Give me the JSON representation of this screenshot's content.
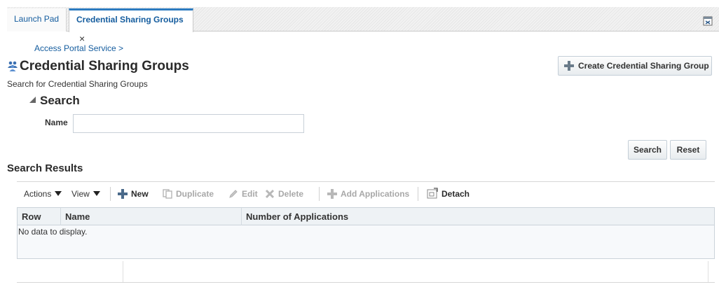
{
  "tabs": [
    {
      "label": "Launch Pad",
      "active": false
    },
    {
      "label": "Credential Sharing Groups",
      "active": true,
      "close": "×"
    }
  ],
  "window": {
    "maximize_icon": "maximize-icon"
  },
  "header": {
    "breadcrumb": "Access Portal Service >",
    "title": "Credential Sharing Groups",
    "title_icon": "people-group-icon",
    "description": "Search for Credential Sharing Groups",
    "create_button": "Create Credential Sharing Group"
  },
  "search": {
    "header": "Search",
    "name_label": "Name",
    "name_value": "",
    "search_button": "Search",
    "reset_button": "Reset"
  },
  "results": {
    "header": "Search Results",
    "toolbar": {
      "actions": "Actions",
      "view": "View",
      "new": "New",
      "duplicate": "Duplicate",
      "edit": "Edit",
      "delete": "Delete",
      "add_applications": "Add Applications",
      "detach": "Detach"
    },
    "columns": [
      "Row",
      "Name",
      "Number of Applications"
    ],
    "rows": [],
    "empty_message": "No data to display."
  },
  "colors": {
    "accent": "#2c7bc0",
    "link": "#145c9e",
    "add_green": "#4a9a3c",
    "disabled": "#a8a8a8"
  }
}
